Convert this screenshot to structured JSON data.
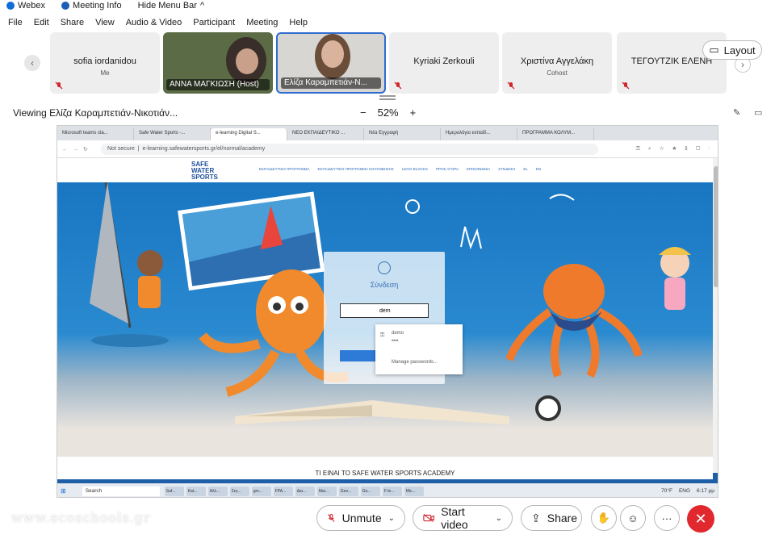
{
  "sysbar": {
    "app": "Webex",
    "meeting_info": "Meeting Info",
    "hide_menu": "Hide Menu Bar"
  },
  "menu": [
    "File",
    "Edit",
    "Share",
    "View",
    "Audio & Video",
    "Participant",
    "Meeting",
    "Help"
  ],
  "participants": [
    {
      "name": "sofia iordanidou",
      "role": "Me"
    },
    {
      "name": "ΑΝΝΑ ΜΑΓΚΙΩΣΗ (Host)"
    },
    {
      "name": "Ελίζα Καραμπετιάν-Ν..."
    },
    {
      "name": "Kyriaki Zerkouli",
      "role": ""
    },
    {
      "name": "Χριστίνα Αγγελάκη",
      "role": "Cohost"
    },
    {
      "name": "ΤΕΓΟΥΤΖΙΚ ΕΛΕΝΗ",
      "role": ""
    }
  ],
  "layout_label": "Layout",
  "viewing": "Viewing Ελίζα Καραμπετιάν-Νικοτιάν...",
  "zoom": {
    "minus": "−",
    "value": "52%",
    "plus": "+"
  },
  "shared": {
    "tabs": [
      "Microsoft teams cla...",
      "Safe Water Sports -...",
      "e-learning Digital S...",
      "ΝΕΟ ΕΚΠΑΙΔΕΥΤΙΚΟ ...",
      "Νέα Εγγραφή",
      "Ημερολόγιο εκπαίδ...",
      "ΠΡΟΓΡΑΜΜΑ ΚΟΛΥΜ..."
    ],
    "not_secure": "Not secure",
    "url": "e-learning.safewatersports.gr/el/normal/academy",
    "logo": [
      "SAFE",
      "WATER",
      "SPORTS"
    ],
    "nav": [
      "ΕΚΠΑΙΔΕΥΤΙΚΟ ΠΡΟΓΡΑΜΜΑ",
      "ΕΚΠΑΙΔΕΥΤΙΚΟ ΠΡΟΓΡΑΜΜΑ ΚΟΛΥΜΒΗΣΗΣ",
      "LEGO BLOCKS",
      "ΠΡΟΣ ΑΓΟΡΑ",
      "ΕΠΙΚΟΙΝΩΝΙΑ",
      "ΣΥΝΔΕΣΗ",
      "EL",
      "EN"
    ],
    "login_title": "Σύνδεση",
    "login_value": "dem",
    "pw_user": "demo",
    "pw_mask": "••••",
    "pw_manage": "Manage passwords...",
    "caption": "ΤΙ ΕΙΝΑΙ ΤΟ SAFE WATER SPORTS ACADEMY",
    "taskbar_search": "Search",
    "taskbar_apps": [
      "Saf...",
      "Kat...",
      "Αλλ...",
      "Σεγ...",
      "gm...",
      "FPA...",
      "Δια...",
      "Mai...",
      "Geo...",
      "Go...",
      "F-le...",
      "Mic..."
    ],
    "tray": [
      "70°F",
      "ENG",
      "6:17 μμ"
    ]
  },
  "controls": {
    "unmute": "Unmute",
    "start_video": "Start video",
    "share": "Share"
  },
  "watermark": "www.ecoschools.gr",
  "colors": {
    "accent": "#2f6dd1",
    "leave": "#e0282e",
    "mute": "#d0262d"
  }
}
